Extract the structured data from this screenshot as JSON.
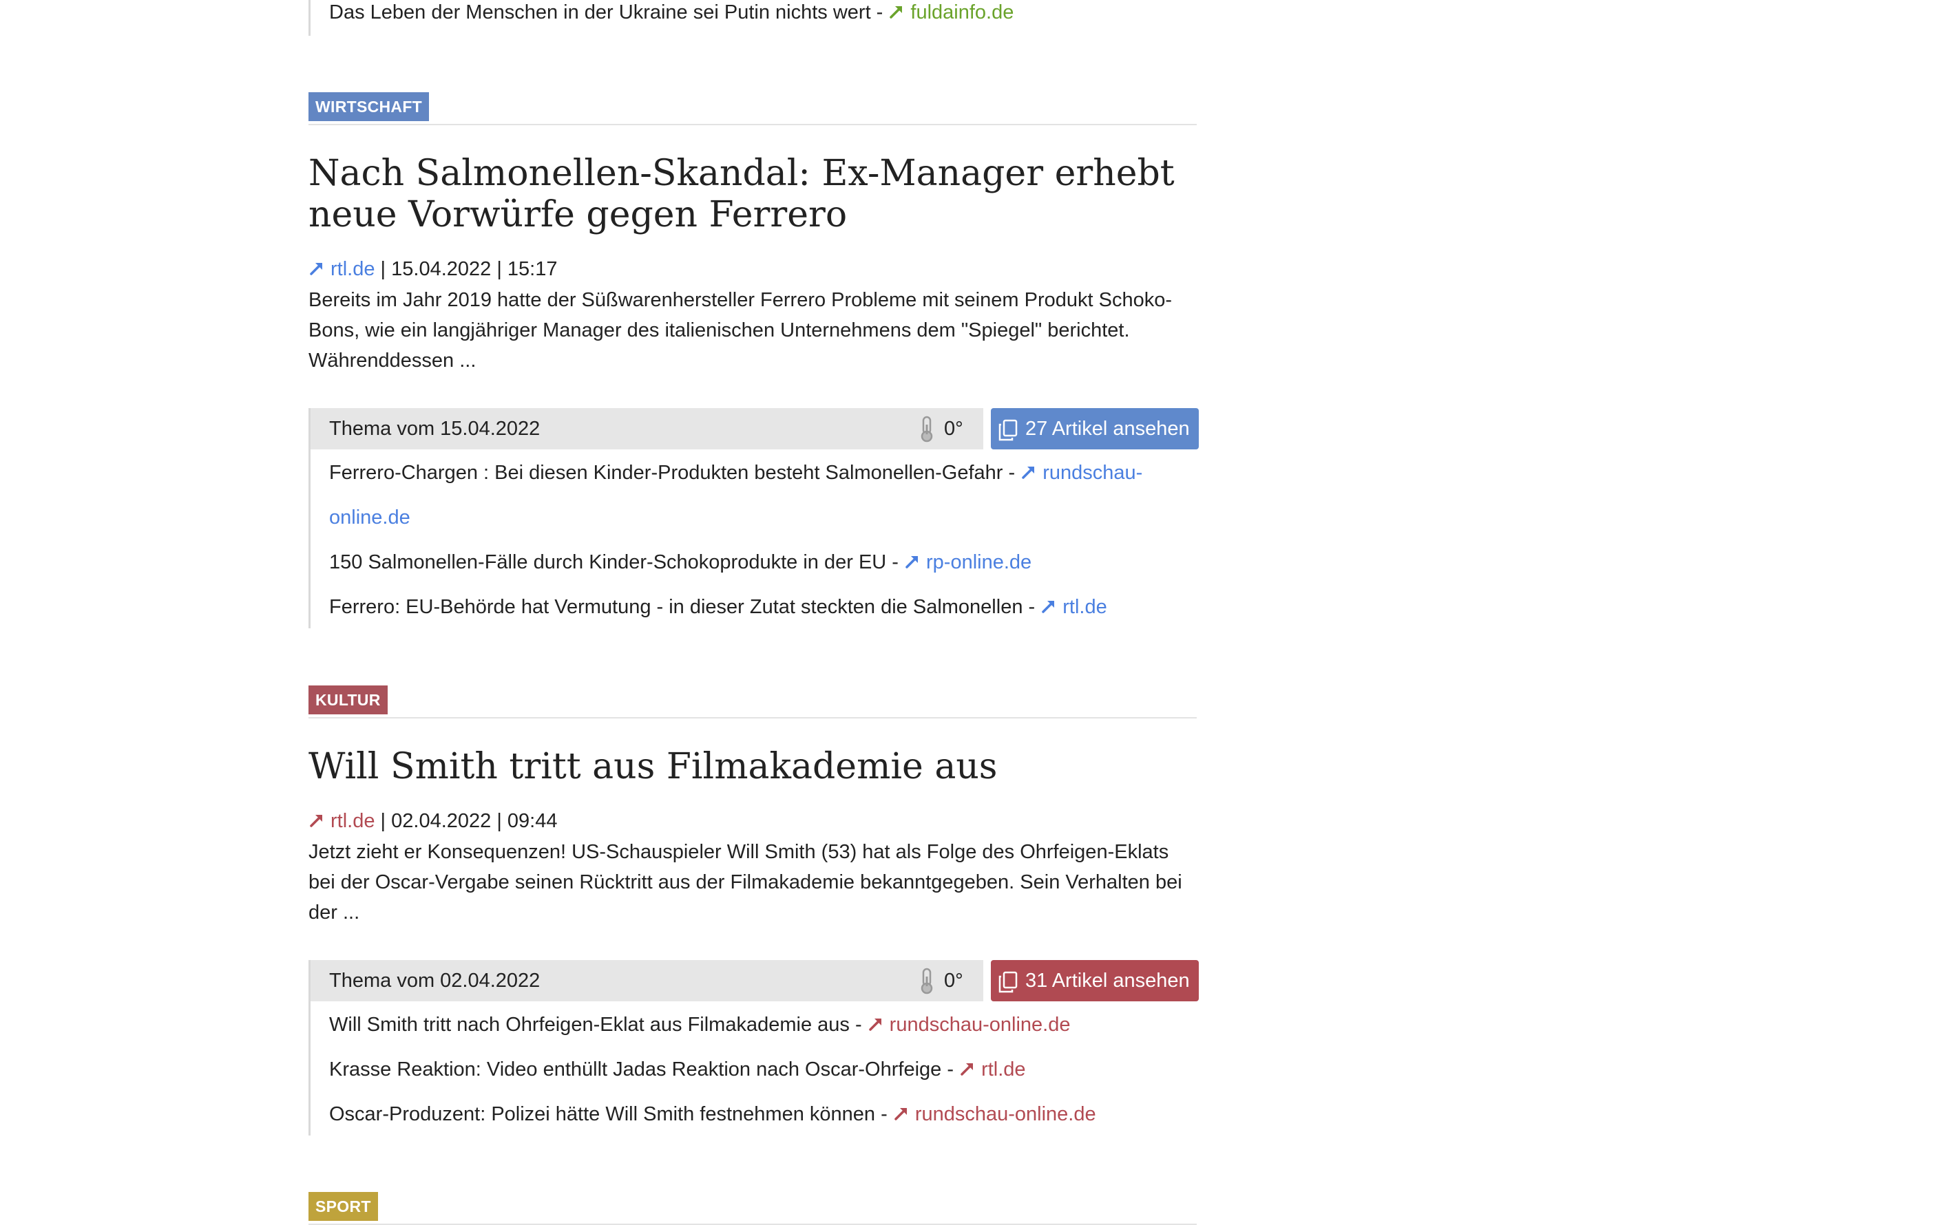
{
  "top_item": {
    "text": "Das Leben der Menschen in der Ukraine sei Putin nichts wert - ",
    "source": "fuldainfo.de"
  },
  "articles": [
    {
      "category": "WIRTSCHAFT",
      "headline": "Nach Salmonellen-Skandal: Ex-Manager erhebt neue Vorwürfe gegen Ferrero",
      "source": "rtl.de",
      "date_time": " | 15.04.2022 | 15:17",
      "teaser": "Bereits im Jahr 2019 hatte der Süßwarenhersteller Ferrero Probleme mit seinem Produkt Schoko-Bons, wie ein langjähriger Manager des italienischen Unternehmens dem \"Spiegel\" berichtet. Währenddessen ...",
      "topic": {
        "label": "Thema vom 15.04.2022",
        "temperature": "0°",
        "button": "27 Artikel ansehen",
        "items": [
          {
            "text": "Ferrero-Chargen : Bei diesen Kinder-Produkten besteht Salmonellen-Gefahr - ",
            "source": "rundschau-online.de"
          },
          {
            "text": "150 Salmonellen-Fälle durch Kinder-Schokoprodukte in der EU - ",
            "source": "rp-online.de"
          },
          {
            "text": "Ferrero: EU-Behörde hat Vermutung - in dieser Zutat steckten die Salmonellen - ",
            "source": "rtl.de"
          }
        ]
      }
    },
    {
      "category": "KULTUR",
      "headline": "Will Smith tritt aus Filmakademie aus",
      "source": "rtl.de",
      "date_time": " | 02.04.2022 | 09:44",
      "teaser": "Jetzt zieht er Konsequenzen! US-Schauspieler Will Smith (53) hat als Folge des Ohrfeigen-Eklats bei der Oscar-Vergabe seinen Rücktritt aus der Filmakademie bekanntgegeben. Sein Verhalten bei der ...",
      "topic": {
        "label": "Thema vom 02.04.2022",
        "temperature": "0°",
        "button": "31 Artikel ansehen",
        "items": [
          {
            "text": "Will Smith tritt nach Ohrfeigen-Eklat aus Filmakademie aus - ",
            "source": "rundschau-online.de"
          },
          {
            "text": "Krasse Reaktion: Video enthüllt Jadas Reaktion nach Oscar-Ohrfeige - ",
            "source": "rtl.de"
          },
          {
            "text": "Oscar-Produzent: Polizei hätte Will Smith festnehmen können - ",
            "source": "rundschau-online.de"
          }
        ]
      }
    }
  ],
  "next_category": "SPORT",
  "colors": {
    "wirtschaft": "#6286c3",
    "kultur": "#a9525a",
    "sport": "#bfa33c",
    "link_blue": "#4a7fe0",
    "link_red": "#b24a52",
    "link_green": "#6aa32b"
  },
  "icons": {
    "source_link": "external-arrow-icon",
    "temperature": "thermometer-icon",
    "view_articles": "copy-icon"
  }
}
